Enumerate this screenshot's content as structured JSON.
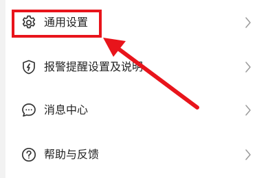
{
  "menu": {
    "items": [
      {
        "label": "通用设置",
        "icon": "gear-icon"
      },
      {
        "label": "报警提醒设置及说明",
        "icon": "shield-lightning-icon"
      },
      {
        "label": "消息中心",
        "icon": "chat-bubble-icon"
      },
      {
        "label": "帮助与反馈",
        "icon": "question-circle-icon"
      }
    ]
  },
  "annotation": {
    "highlight_color": "#e8141b"
  }
}
